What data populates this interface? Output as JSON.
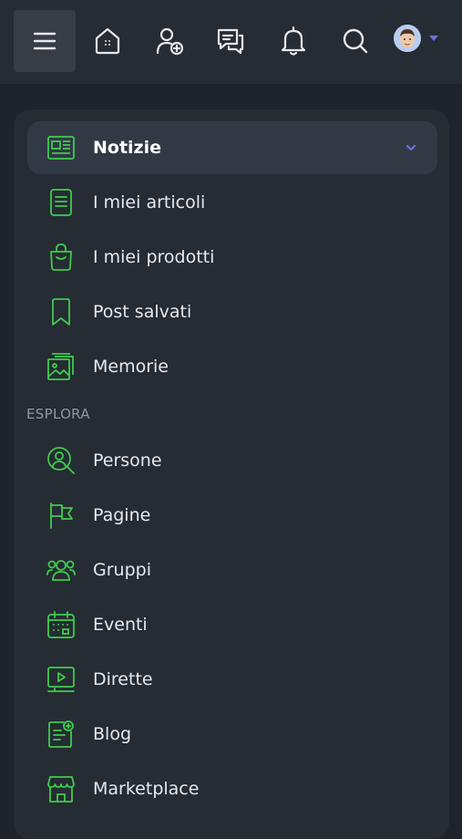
{
  "topbar": {
    "icons": [
      "menu-icon",
      "home-icon",
      "add-friend-icon",
      "messages-icon",
      "bell-icon",
      "search-icon",
      "avatar"
    ]
  },
  "colors": {
    "accent_green": "#3fcb4f",
    "accent_purple": "#6b73d6",
    "background": "#1f242a",
    "panel": "#262c33"
  },
  "nav": {
    "items": [
      {
        "label": "Notizie",
        "icon": "newspaper-icon",
        "active": true
      },
      {
        "label": "I miei articoli",
        "icon": "document-icon"
      },
      {
        "label": "I miei prodotti",
        "icon": "shopping-bag-icon"
      },
      {
        "label": "Post salvati",
        "icon": "bookmark-icon"
      },
      {
        "label": "Memorie",
        "icon": "photos-icon"
      }
    ],
    "section_label": "ESPLORA",
    "explore": [
      {
        "label": "Persone",
        "icon": "user-search-icon"
      },
      {
        "label": "Pagine",
        "icon": "flag-icon"
      },
      {
        "label": "Gruppi",
        "icon": "users-icon"
      },
      {
        "label": "Eventi",
        "icon": "calendar-icon"
      },
      {
        "label": "Dirette",
        "icon": "live-video-icon"
      },
      {
        "label": "Blog",
        "icon": "blog-icon"
      },
      {
        "label": "Marketplace",
        "icon": "store-icon"
      }
    ]
  }
}
